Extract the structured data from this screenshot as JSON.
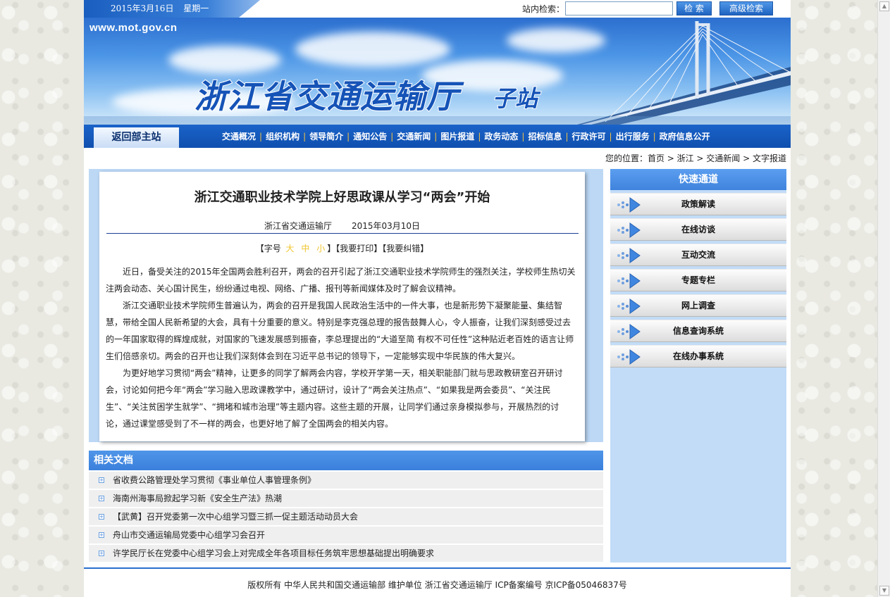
{
  "topbar": {
    "date": "2015年3月16日",
    "weekday": "星期一",
    "search_label": "站内检索：",
    "search_value": "",
    "search_button": "检  索",
    "advanced_button": "高级检索"
  },
  "banner": {
    "url": "www.mot.gov.cn",
    "title": "浙江省交通运输厅",
    "subtitle": "子站"
  },
  "nav": {
    "back_label": "返回部主站",
    "items": [
      "交通概况",
      "组织机构",
      "领导简介",
      "通知公告",
      "交通新闻",
      "图片报道",
      "政务动态",
      "招标信息",
      "行政许可",
      "出行服务",
      "政府信息公开"
    ],
    "separator": "|"
  },
  "breadcrumb": "您的位置：首页 > 浙江 > 交通新闻 > 文字报道",
  "article": {
    "title": "浙江交通职业技术学院上好思政课从学习“两会”开始",
    "source": "浙江省交通运输厅",
    "date": "2015年03月10日",
    "tools": {
      "font_label": "【字号",
      "size_large": "大",
      "size_medium": "中",
      "size_small": "小",
      "print": "】【我要打印】",
      "correct": "【我要纠错】"
    },
    "paragraphs": [
      "近日，备受关注的2015年全国两会胜利召开，两会的召开引起了浙江交通职业技术学院师生的强烈关注，学校师生热切关注两会动态、关心国计民生，纷纷通过电视、网络、广播、报刊等新闻媒体及时了解会议精神。",
      "浙江交通职业技术学院师生普遍认为，两会的召开是我国人民政治生活中的一件大事，也是新形势下凝聚能量、集结智慧，带给全国人民新希望的大会，具有十分重要的意义。特别是李克强总理的报告鼓舞人心，令人振奋，让我们深刻感受过去的一年国家取得的辉煌成就，对国家的飞速发展感到振奋，李总理提出的“大道至简 有权不可任性”这种贴近老百姓的语言让师生们倍感亲切。两会的召开也让我们深刻体会到在习近平总书记的领导下，一定能够实现中华民族的伟大复兴。",
      "为更好地学习贯彻“两会”精神，让更多的同学了解两会内容，学校开学第一天，相关职能部门就与思政教研室召开研讨会，讨论如何把今年“两会”学习融入思政课教学中，通过研讨，设计了“两会关注热点”、“如果我是两会委员”、“关注民生”、“关注贫困学生就学”、“拥堵和城市治理”等主题内容。这些主题的开展，让同学们通过亲身模拟参与，开展热烈的讨论，通过课堂感受到了不一样的两会，也更好地了解了全国两会的相关内容。"
    ]
  },
  "related": {
    "title": "相关文档",
    "items": [
      "省收费公路管理处学习贯彻《事业单位人事管理条例》",
      "海南州海事局掀起学习新《安全生产法》热潮",
      "【武黄】召开党委第一次中心组学习暨三抓一促主题活动动员大会",
      "舟山市交通运输局党委中心组学习会召开",
      "许学民厅长在党委中心组学习会上对完成全年各项目标任务筑牢思想基础提出明确要求"
    ]
  },
  "quick": {
    "title": "快速通道",
    "items": [
      "政策解读",
      "在线访谈",
      "互动交流",
      "专题专栏",
      "网上调查",
      "信息查询系统",
      "在线办事系统"
    ]
  },
  "footer": "版权所有  中华人民共和国交通运输部  维护单位  浙江省交通运输厅  ICP备案编号  京ICP备05046837号",
  "colors": {
    "nav_blue": "#0f4fae",
    "panel_blue": "#bcd8f5",
    "accent_gold": "#f0c52e"
  }
}
